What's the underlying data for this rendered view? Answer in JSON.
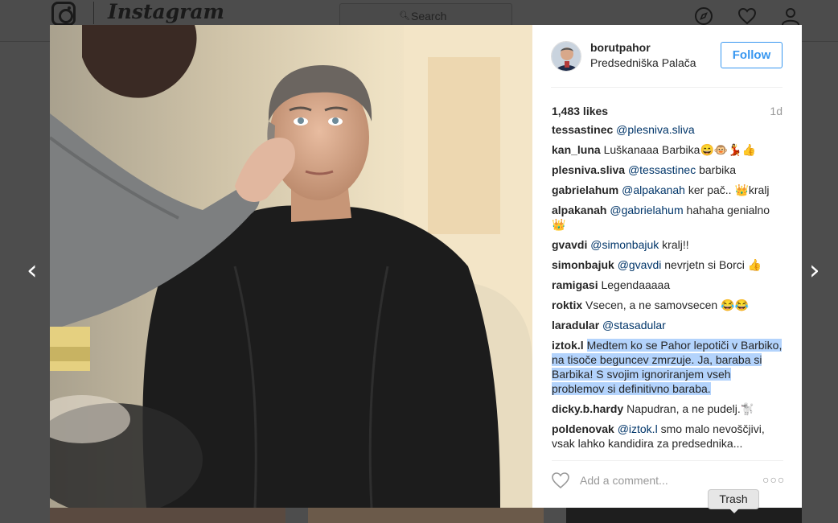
{
  "topbar": {
    "brand": "Instagram",
    "search_placeholder": "Search",
    "icons": [
      "compass-icon",
      "heart-icon",
      "user-icon"
    ]
  },
  "post": {
    "author": {
      "username": "borutpahor",
      "location": "Predsedniška Palača"
    },
    "follow_label": "Follow",
    "likes": "1,483 likes",
    "age": "1d",
    "comments": [
      {
        "user": "tessastinec",
        "parts": [
          {
            "t": "@plesniva.sliva",
            "m": true
          }
        ]
      },
      {
        "user": "kan_luna",
        "parts": [
          {
            "t": "Luškanaaa Barbika😄🐵💃👍",
            "m": false
          }
        ]
      },
      {
        "user": "plesniva.sliva",
        "parts": [
          {
            "t": "@tessastinec",
            "m": true
          },
          {
            "t": " barbika",
            "m": false
          }
        ]
      },
      {
        "user": "gabrielahum",
        "parts": [
          {
            "t": "@alpakanah",
            "m": true
          },
          {
            "t": " ker pač.. 👑kralj",
            "m": false
          }
        ]
      },
      {
        "user": "alpakanah",
        "parts": [
          {
            "t": "@gabrielahum",
            "m": true
          },
          {
            "t": " hahaha genialno 👑",
            "m": false
          }
        ]
      },
      {
        "user": "gvavdi",
        "parts": [
          {
            "t": "@simonbajuk",
            "m": true
          },
          {
            "t": " kralj!!",
            "m": false
          }
        ]
      },
      {
        "user": "simonbajuk",
        "parts": [
          {
            "t": "@gvavdi",
            "m": true
          },
          {
            "t": " nevrjetn si Borci 👍",
            "m": false
          }
        ]
      },
      {
        "user": "ramigasi",
        "parts": [
          {
            "t": "Legendaaaaa",
            "m": false
          }
        ]
      },
      {
        "user": "roktix",
        "parts": [
          {
            "t": "Vsecen, a ne samovsecen 😂😂",
            "m": false
          }
        ]
      },
      {
        "user": "laradular",
        "parts": [
          {
            "t": "@stasadular",
            "m": true
          }
        ]
      },
      {
        "user": "iztok.l",
        "parts": [
          {
            "t": "Medtem ko se Pahor lepotiči v Barbiko, na tisoče beguncev zmrzuje. Ja, baraba si Barbika! S svojim ignoriranjem vseh problemov si definitivno baraba.",
            "m": false,
            "h": true
          }
        ]
      },
      {
        "user": "dicky.b.hardy",
        "parts": [
          {
            "t": "Napudran, a ne pudelj.🐩",
            "m": false
          }
        ]
      },
      {
        "user": "poldenovak",
        "parts": [
          {
            "t": "@iztok.l",
            "m": true
          },
          {
            "t": " smo malo nevoščjivi, vsak lahko kandidira za predsednika...",
            "m": false
          }
        ]
      }
    ],
    "add_comment_placeholder": "Add a comment...",
    "more_label": "○○○"
  },
  "navigation": {
    "prev_arrow": "‹",
    "next_arrow": "›"
  },
  "tooltip": "Trash",
  "colors": {
    "accent": "#3897f0",
    "mention": "#003569",
    "highlight": "#b3d3fc",
    "overlay": "#4d4d4d"
  }
}
